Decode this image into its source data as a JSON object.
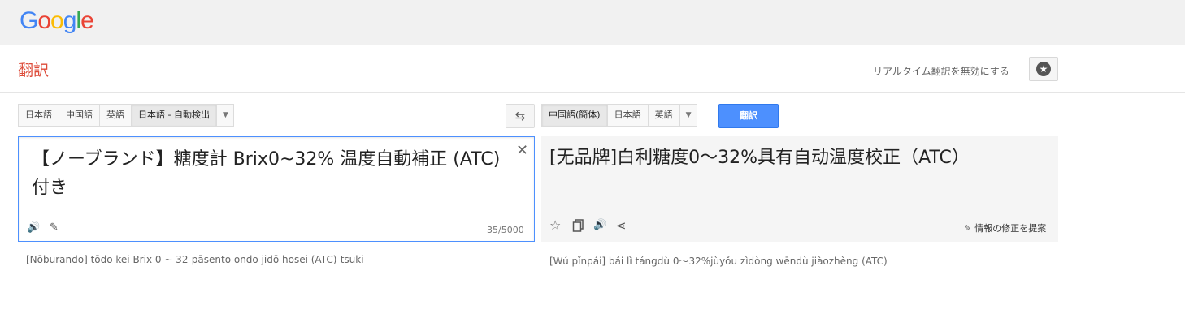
{
  "header": {
    "logo_letters": [
      {
        "char": "G",
        "color": "#4285f4"
      },
      {
        "char": "o",
        "color": "#ea4335"
      },
      {
        "char": "o",
        "color": "#fbbc05"
      },
      {
        "char": "g",
        "color": "#4285f4"
      },
      {
        "char": "l",
        "color": "#34a853"
      },
      {
        "char": "e",
        "color": "#ea4335"
      }
    ]
  },
  "subheader": {
    "title": "翻訳",
    "realtime_link": "リアルタイム翻訳を無効にする",
    "star_icon": "star-circle-icon"
  },
  "source": {
    "languages": [
      "日本語",
      "中国語",
      "英語",
      "日本語 - 自動検出"
    ],
    "selected_index": 3,
    "text": "【ノーブランド】糖度計 Brix0~32% 温度自動補正 (ATC)付き",
    "char_count": "35/5000",
    "romanization": "[Nōburando] tōdo kei Brix 0 ~ 32-pāsento ondo jidō hosei (ATC)-tsuki"
  },
  "target": {
    "languages": [
      "中国語(簡体)",
      "日本語",
      "英語"
    ],
    "selected_index": 0,
    "translate_button": "翻訳",
    "text": "[无品牌]白利糖度0〜32%具有自动温度校正（ATC）",
    "suggest_edit": "情報の修正を提案",
    "romanization": "[Wú pǐnpái] bái lì tángdù 0〜32%jùyǒu zìdòng wēndù jiàozhèng (ATC)"
  },
  "colors": {
    "accent_blue": "#4d90fe",
    "title_red": "#dd4b39",
    "topbar_bg": "#f1f1f1",
    "target_bg": "#f5f5f5"
  }
}
